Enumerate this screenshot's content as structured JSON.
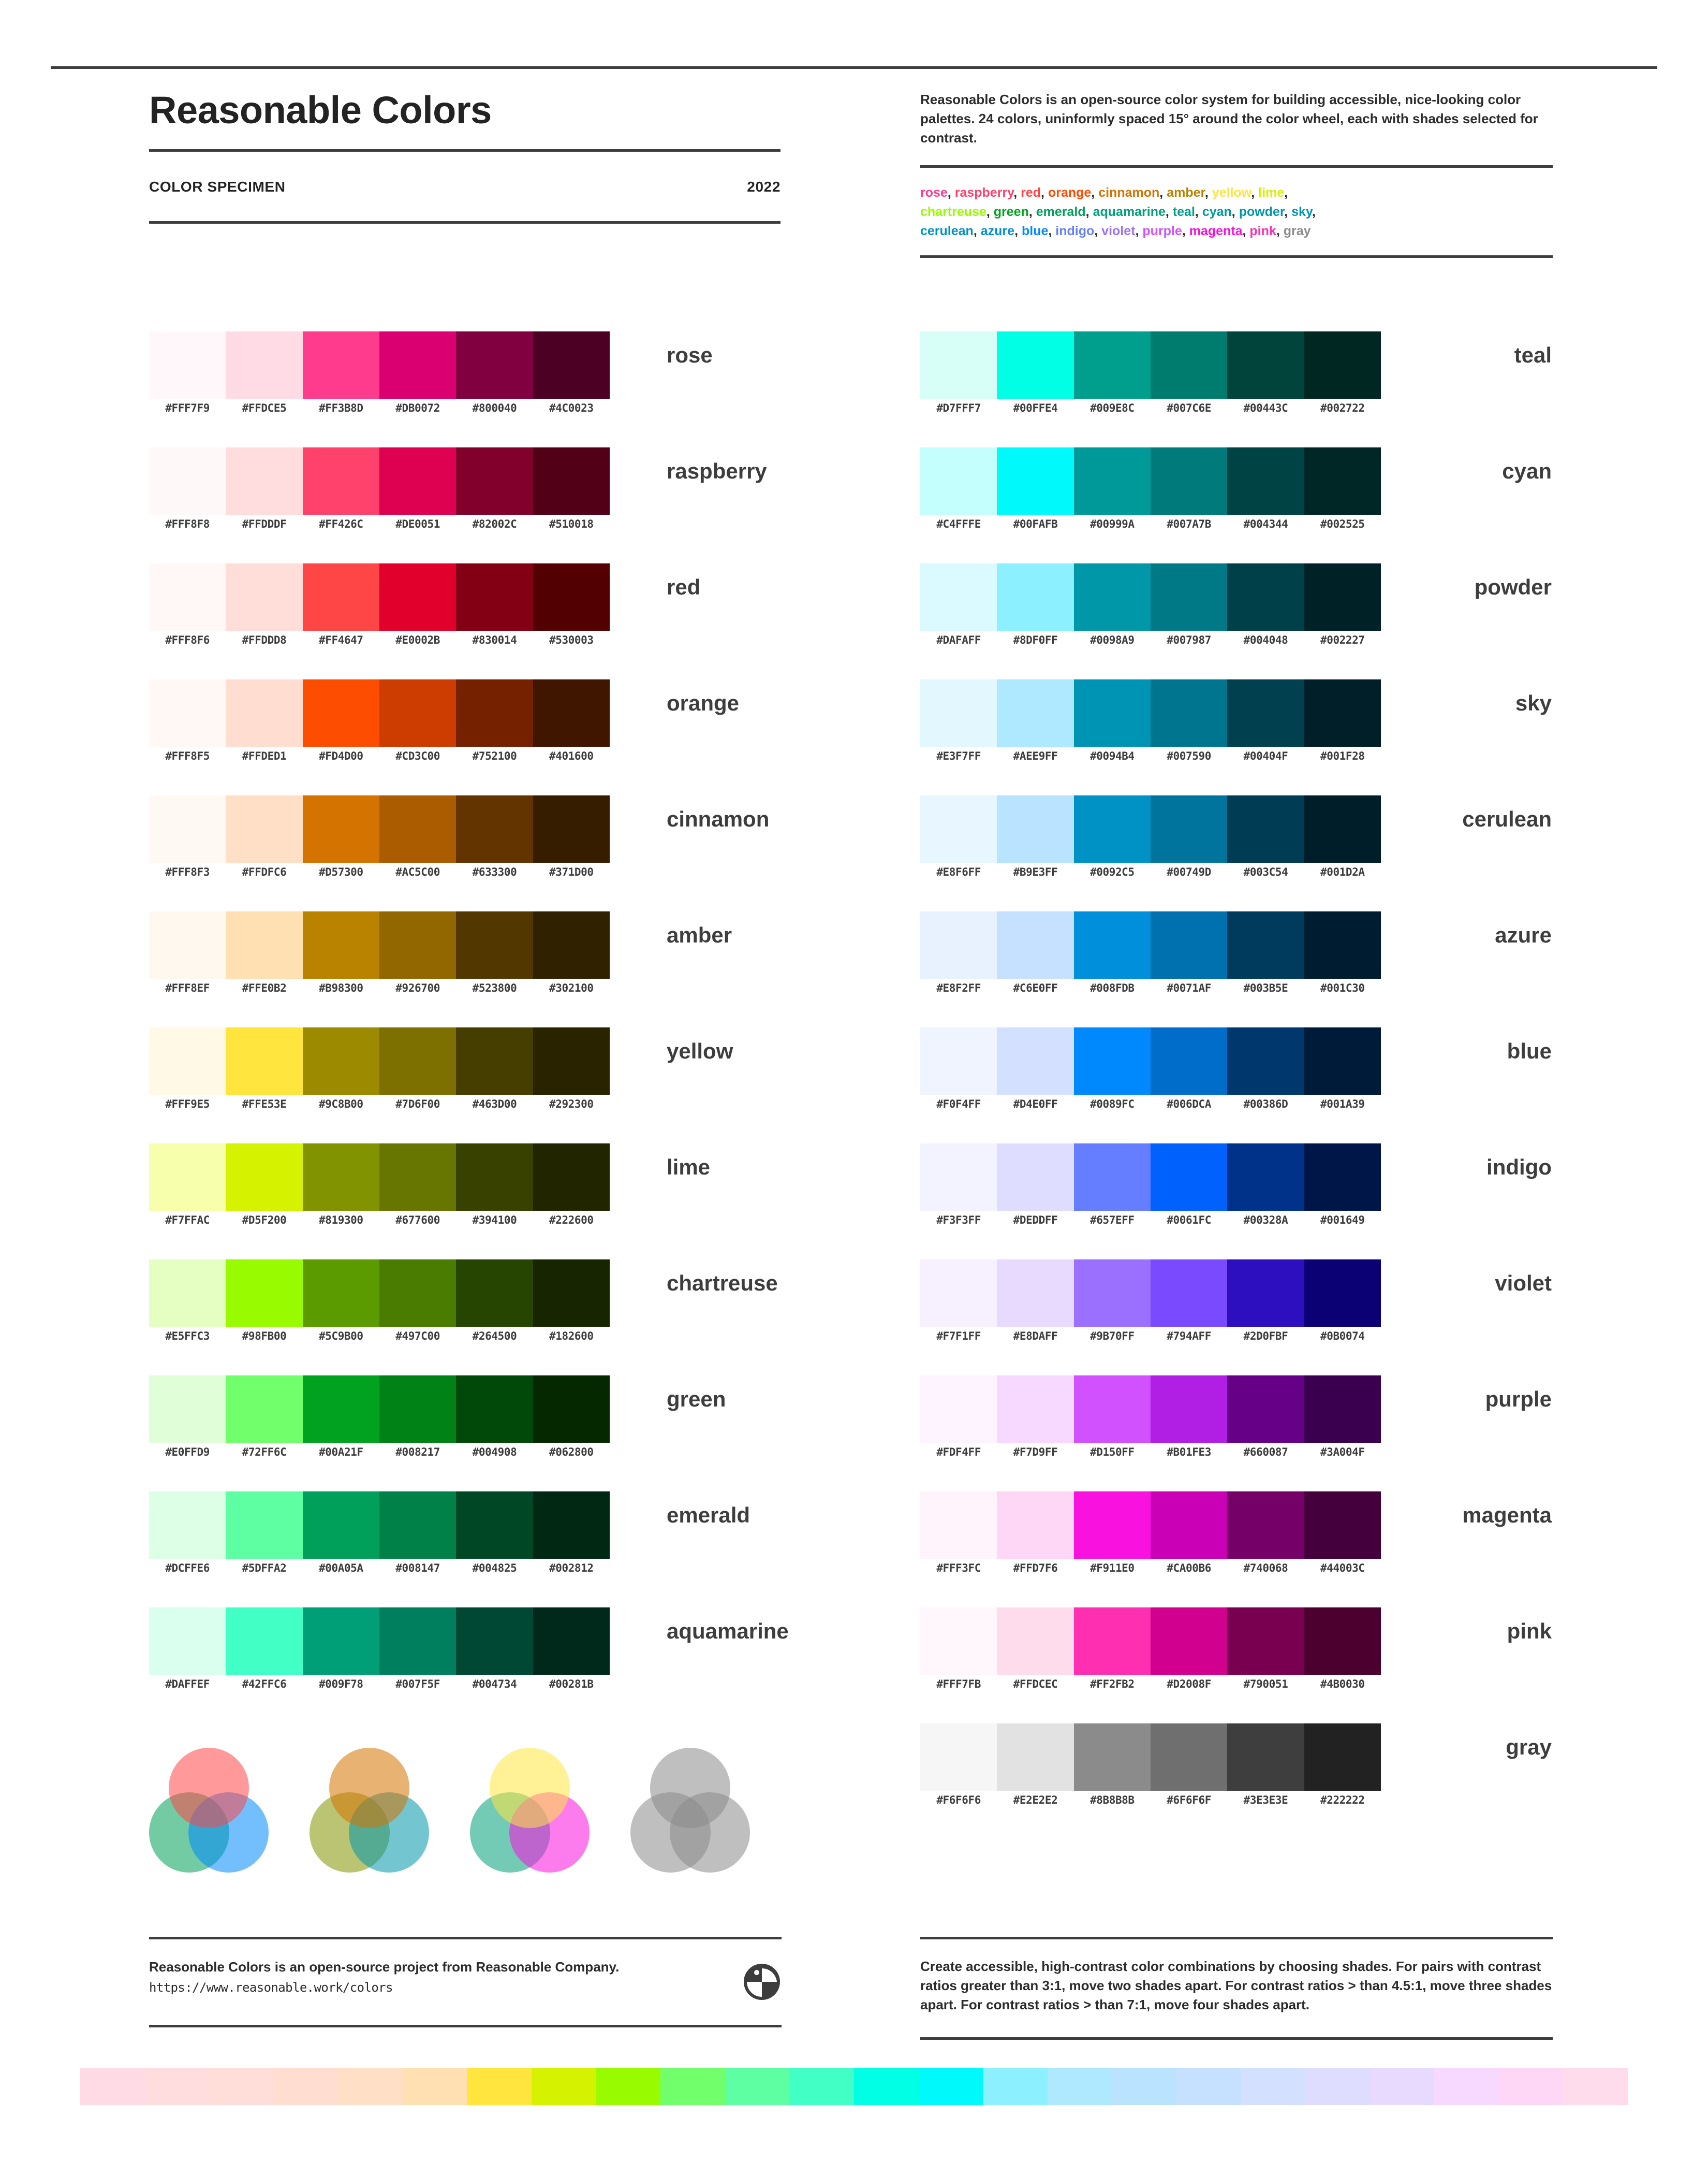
{
  "header": {
    "title": "Reasonable Colors",
    "specimen_label": "COLOR SPECIMEN",
    "year": "2022",
    "description": "Reasonable Colors is an open-source color system for building accessible, nice-looking color palettes. 24 colors, uninformly spaced 15° around the color wheel, each with shades selected for contrast.",
    "name_list_line1": "rose, raspberry, red, orange, cinnamon, amber, yellow, lime,",
    "name_list_line2": "chartreuse, green, emerald, aquamarine, teal, cyan, powder, sky,",
    "name_list_line3": "cerulean, azure, blue, indigo, violet, purple, magenta, pink, gray"
  },
  "name_list_tokens": [
    {
      "text": "rose",
      "color": "#FF3B8D"
    },
    {
      "text": "raspberry",
      "color": "#FF426C"
    },
    {
      "text": "red",
      "color": "#FF4647"
    },
    {
      "text": "orange",
      "color": "#FD4D00"
    },
    {
      "text": "cinnamon",
      "color": "#D57300"
    },
    {
      "text": "amber",
      "color": "#B98300"
    },
    {
      "text": "yellow",
      "color": "#FFE53E"
    },
    {
      "text": "lime",
      "color": "#D5F200"
    },
    {
      "text": "chartreuse",
      "color": "#98FB00"
    },
    {
      "text": "green",
      "color": "#00A21F"
    },
    {
      "text": "emerald",
      "color": "#00A05A"
    },
    {
      "text": "aquamarine",
      "color": "#009F78"
    },
    {
      "text": "teal",
      "color": "#009E8C"
    },
    {
      "text": "cyan",
      "color": "#00999A"
    },
    {
      "text": "powder",
      "color": "#0098A9"
    },
    {
      "text": "sky",
      "color": "#0094B4"
    },
    {
      "text": "cerulean",
      "color": "#0092C5"
    },
    {
      "text": "azure",
      "color": "#008FDB"
    },
    {
      "text": "blue",
      "color": "#0089FC"
    },
    {
      "text": "indigo",
      "color": "#657EFF"
    },
    {
      "text": "violet",
      "color": "#9B70FF"
    },
    {
      "text": "purple",
      "color": "#D150FF"
    },
    {
      "text": "magenta",
      "color": "#F911E0"
    },
    {
      "text": "pink",
      "color": "#FF2FB2"
    },
    {
      "text": "gray",
      "color": "#8B8B8B"
    }
  ],
  "palettes_left": [
    {
      "name": "rose",
      "shades": [
        "#FFF7F9",
        "#FFDCE5",
        "#FF3B8D",
        "#DB0072",
        "#800040",
        "#4C0023"
      ]
    },
    {
      "name": "raspberry",
      "shades": [
        "#FFF8F8",
        "#FFDDDF",
        "#FF426C",
        "#DE0051",
        "#82002C",
        "#510018"
      ]
    },
    {
      "name": "red",
      "shades": [
        "#FFF8F6",
        "#FFDDD8",
        "#FF4647",
        "#E0002B",
        "#830014",
        "#530003"
      ]
    },
    {
      "name": "orange",
      "shades": [
        "#FFF8F5",
        "#FFDED1",
        "#FD4D00",
        "#CD3C00",
        "#752100",
        "#401600"
      ]
    },
    {
      "name": "cinnamon",
      "shades": [
        "#FFF8F3",
        "#FFDFC6",
        "#D57300",
        "#AC5C00",
        "#633300",
        "#371D00"
      ]
    },
    {
      "name": "amber",
      "shades": [
        "#FFF8EF",
        "#FFE0B2",
        "#B98300",
        "#926700",
        "#523800",
        "#302100"
      ]
    },
    {
      "name": "yellow",
      "shades": [
        "#FFF9E5",
        "#FFE53E",
        "#9C8B00",
        "#7D6F00",
        "#463D00",
        "#292300"
      ]
    },
    {
      "name": "lime",
      "shades": [
        "#F7FFAC",
        "#D5F200",
        "#819300",
        "#677600",
        "#394100",
        "#222600"
      ]
    },
    {
      "name": "chartreuse",
      "shades": [
        "#E5FFC3",
        "#98FB00",
        "#5C9B00",
        "#497C00",
        "#264500",
        "#182600"
      ]
    },
    {
      "name": "green",
      "shades": [
        "#E0FFD9",
        "#72FF6C",
        "#00A21F",
        "#008217",
        "#004908",
        "#062800"
      ]
    },
    {
      "name": "emerald",
      "shades": [
        "#DCFFE6",
        "#5DFFA2",
        "#00A05A",
        "#008147",
        "#004825",
        "#002812"
      ]
    },
    {
      "name": "aquamarine",
      "shades": [
        "#DAFFEF",
        "#42FFC6",
        "#009F78",
        "#007F5F",
        "#004734",
        "#00281B"
      ]
    }
  ],
  "palettes_right": [
    {
      "name": "teal",
      "shades": [
        "#D7FFF7",
        "#00FFE4",
        "#009E8C",
        "#007C6E",
        "#00443C",
        "#002722"
      ]
    },
    {
      "name": "cyan",
      "shades": [
        "#C4FFFE",
        "#00FAFB",
        "#00999A",
        "#007A7B",
        "#004344",
        "#002525"
      ]
    },
    {
      "name": "powder",
      "shades": [
        "#DAFAFF",
        "#8DF0FF",
        "#0098A9",
        "#007987",
        "#004048",
        "#002227"
      ]
    },
    {
      "name": "sky",
      "shades": [
        "#E3F7FF",
        "#AEE9FF",
        "#0094B4",
        "#007590",
        "#00404F",
        "#001F28"
      ]
    },
    {
      "name": "cerulean",
      "shades": [
        "#E8F6FF",
        "#B9E3FF",
        "#0092C5",
        "#00749D",
        "#003C54",
        "#001D2A"
      ]
    },
    {
      "name": "azure",
      "shades": [
        "#E8F2FF",
        "#C6E0FF",
        "#008FDB",
        "#0071AF",
        "#003B5E",
        "#001C30"
      ]
    },
    {
      "name": "blue",
      "shades": [
        "#F0F4FF",
        "#D4E0FF",
        "#0089FC",
        "#006DCA",
        "#00386D",
        "#001A39"
      ]
    },
    {
      "name": "indigo",
      "shades": [
        "#F3F3FF",
        "#DEDDFF",
        "#657EFF",
        "#0061FC",
        "#00328A",
        "#001649"
      ]
    },
    {
      "name": "violet",
      "shades": [
        "#F7F1FF",
        "#E8DAFF",
        "#9B70FF",
        "#794AFF",
        "#2D0FBF",
        "#0B0074"
      ]
    },
    {
      "name": "purple",
      "shades": [
        "#FDF4FF",
        "#F7D9FF",
        "#D150FF",
        "#B01FE3",
        "#660087",
        "#3A004F"
      ]
    },
    {
      "name": "magenta",
      "shades": [
        "#FFF3FC",
        "#FFD7F6",
        "#F911E0",
        "#CA00B6",
        "#740068",
        "#44003C"
      ]
    },
    {
      "name": "pink",
      "shades": [
        "#FFF7FB",
        "#FFDCEC",
        "#FF2FB2",
        "#D2008F",
        "#790051",
        "#4B0030"
      ]
    },
    {
      "name": "gray",
      "shades": [
        "#F6F6F6",
        "#E2E2E2",
        "#8B8B8B",
        "#6F6F6F",
        "#3E3E3E",
        "#222222"
      ]
    }
  ],
  "venn_groups": [
    {
      "top": "#FF4647",
      "left": "#00A05A",
      "right": "#0089FC"
    },
    {
      "top": "#D57300",
      "left": "#819300",
      "right": "#0098A9"
    },
    {
      "top": "#FFE53E",
      "left": "#009F78",
      "right": "#F911E0"
    },
    {
      "top": "#8B8B8B",
      "left": "#8B8B8B",
      "right": "#8B8B8B"
    }
  ],
  "footer": {
    "left_text": "Reasonable Colors is an open-source project from Reasonable Company.",
    "left_url": "https://www.reasonable.work/colors",
    "right_note": "Create accessible, high-contrast color combinations by choosing shades. For pairs with contrast ratios greater than 3:1, move two shades apart. For contrast ratios > than 4.5:1, move three shades apart. For contrast ratios > than 7:1, move four shades apart."
  },
  "bottom_bar": [
    "#FFDCE5",
    "#FFDDDF",
    "#FFDDD8",
    "#FFDED1",
    "#FFDFC6",
    "#FFE0B2",
    "#FFE53E",
    "#D5F200",
    "#98FB00",
    "#72FF6C",
    "#5DFFA2",
    "#42FFC6",
    "#00FFE4",
    "#00FAFB",
    "#8DF0FF",
    "#AEE9FF",
    "#B9E3FF",
    "#C6E0FF",
    "#D4E0FF",
    "#DEDDFF",
    "#E8DAFF",
    "#F7D9FF",
    "#FFD7F6",
    "#FFDCEC"
  ]
}
